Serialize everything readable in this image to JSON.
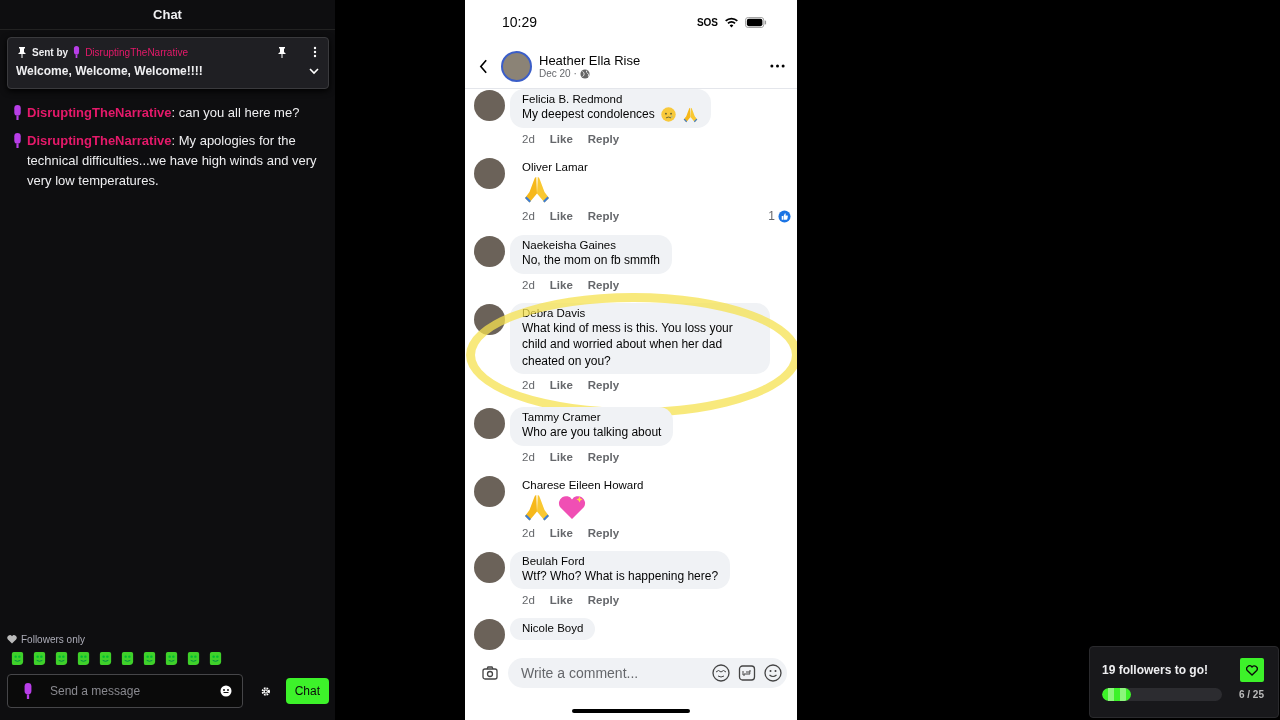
{
  "chat": {
    "title": "Chat",
    "pinned": {
      "label": "Sent by",
      "user": "DisruptingTheNarrative",
      "message": "Welcome, Welcome, Welcome!!!!"
    },
    "messages": [
      {
        "user": "DisruptingTheNarrative",
        "separator": ":",
        "text": "can you all here me?"
      },
      {
        "user": "DisruptingTheNarrative",
        "separator": ":",
        "text": "My apologies for the technical difficulties...we have high winds and very very low temperatures."
      }
    ],
    "mode": "Followers only",
    "input": {
      "placeholder": "Send a message"
    },
    "send_button": "Chat"
  },
  "phone": {
    "status": {
      "time": "10:29",
      "carrier": "SOS"
    },
    "post": {
      "author": "Heather Ella Rise",
      "date": "Dec 20 ·"
    },
    "comments": [
      {
        "name": "Felicia B. Redmond",
        "text": "My deepest condolences",
        "emojis": [
          {
            "kind": "tear"
          },
          {
            "kind": "pray"
          }
        ],
        "time": "2d",
        "like": "Like",
        "reply": "Reply",
        "highlighted": false
      },
      {
        "name": "Oliver Lamar",
        "emojis": [
          {
            "kind": "pray"
          }
        ],
        "time": "2d",
        "like": "Like",
        "reply": "Reply",
        "reactions": "1",
        "highlighted": false
      },
      {
        "name": "Naekeisha Gaines",
        "text": "No, the mom on fb smmfh",
        "time": "2d",
        "like": "Like",
        "reply": "Reply",
        "highlighted": false
      },
      {
        "name": "Debra Davis",
        "text": "What kind of mess is this. You loss your child and worried about when her dad cheated on you?",
        "time": "2d",
        "like": "Like",
        "reply": "Reply",
        "highlighted": true
      },
      {
        "name": "Tammy Cramer",
        "text": "Who are you talking about",
        "time": "2d",
        "like": "Like",
        "reply": "Reply",
        "highlighted": false
      },
      {
        "name": "Charese Eileen Howard",
        "emojis": [
          {
            "kind": "pray"
          },
          {
            "kind": "heart"
          }
        ],
        "time": "2d",
        "like": "Like",
        "reply": "Reply",
        "highlighted": false
      },
      {
        "name": "Beulah Ford",
        "text": "Wtf? Who? What is happening here?",
        "time": "2d",
        "like": "Like",
        "reply": "Reply",
        "highlighted": false
      },
      {
        "name": "Nicole Boyd",
        "highlighted": false
      }
    ],
    "comment_input": {
      "placeholder": "Write a comment..."
    }
  },
  "goal": {
    "title": "19 followers to go!",
    "level": 0.24,
    "count": "6 / 25"
  }
}
